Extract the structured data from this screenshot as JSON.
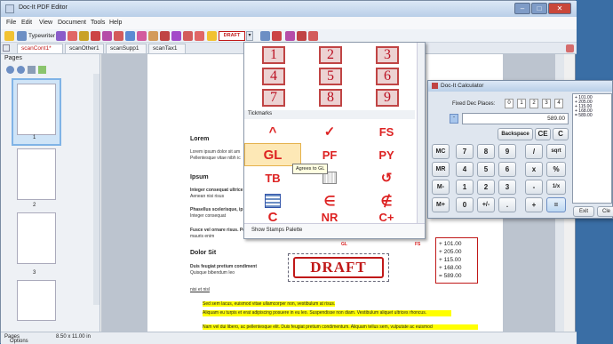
{
  "window": {
    "title": "Doc-It PDF Editor"
  },
  "menu": [
    "File",
    "Edit",
    "View",
    "Document",
    "Tools",
    "Help"
  ],
  "toolbar": {
    "typewriter_label": "Typewriter",
    "draft_label": "DRAFT"
  },
  "tabs": [
    "scanCont1*",
    "scanOther1",
    "scanSupp1",
    "scanTax1"
  ],
  "pages_panel": {
    "title": "Pages",
    "thumbs": [
      "1",
      "2",
      "3"
    ],
    "footer": "Pages",
    "options": "Options"
  },
  "status": {
    "page_size": "8.50 x 11.00 in"
  },
  "document": {
    "heading1": "Lorem",
    "lorem1": "Lorem ipsum dolor sit am",
    "lorem2": "Pellentesque vitae nibh ic",
    "heading2": "Ipsum",
    "ipsum1": "Integer consequat ultrice",
    "ipsum2": "Aenean nisi risus",
    "ph1": "Phasellus scelerisque, ip",
    "ph2": "Integer consequat",
    "fu1": "Fusce vel ornare risus. Pe",
    "fu2": "mauris enim",
    "heading3": "Dolor Sit",
    "ds1": "Duis feugiat pretium condiment",
    "ds2": "Quisque bibendum leo",
    "link": "nisi et nisl",
    "bullets": [
      "Sed sem lacus, euismod vitae ullamcorper non, vestibulum at risus.",
      "Aliquam eu turpis et erat adipiscing posuere in eu leo. Suspendisse non diam. Vestibulum aliquet ultrices rhoncus.",
      "Nam vel dui libero, ac pellentesque elit. Duis feugiat pretium condimentum. Aliquam tellus sem, vulputate ac euismod"
    ],
    "stamp_gl": "GL",
    "stamp_fs": "FS",
    "stamp_draft": "DRAFT",
    "sum_lines": [
      "+ 101.00",
      "+ 205.00",
      "+ 115.00",
      "+ 168.00",
      "= 589.00"
    ]
  },
  "palette": {
    "digits": [
      "1",
      "2",
      "3",
      "4",
      "5",
      "6",
      "7",
      "8",
      "9"
    ],
    "section": "Tickmarks",
    "marks": [
      "^",
      "✓",
      "FS",
      "GL",
      "PF",
      "PY",
      "TB",
      "",
      "↺",
      "",
      "∈",
      "∉",
      "C",
      "NR",
      "C+"
    ],
    "tooltip": "Agrees to GL",
    "footer": "Show Stamps Palette"
  },
  "calculator": {
    "title": "Doc-It Calculator",
    "fixed_label": "Fixed Dec Places:",
    "places": [
      "0",
      "1",
      "2",
      "3",
      "4"
    ],
    "display": "589.00",
    "tape": [
      "+ 101.00",
      "+ 205.00",
      "+ 115.00",
      "+ 168.00",
      "= 589.00"
    ],
    "backspace": "Backspace",
    "ce": "CE",
    "c": "C",
    "row1": [
      "MC",
      "7",
      "8",
      "9",
      "/",
      "sqrt"
    ],
    "row2": [
      "MR",
      "4",
      "5",
      "6",
      "x",
      "%"
    ],
    "row3": [
      "M-",
      "1",
      "2",
      "3",
      "-",
      "1/x"
    ],
    "row4": [
      "M+",
      "0",
      "+/-",
      ".",
      "+",
      "="
    ],
    "exit": "Exit",
    "clear": "Cle"
  },
  "colors": {
    "accent": "#c01818",
    "highlight": "#ffff00",
    "stamp_red": "#d22222"
  }
}
